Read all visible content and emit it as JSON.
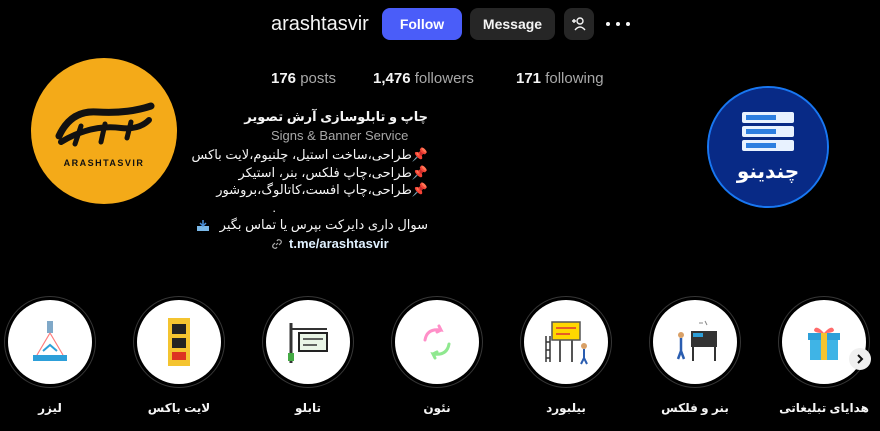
{
  "profile": {
    "username": "arashtasvir",
    "follow_label": "Follow",
    "message_label": "Message",
    "stats": {
      "posts_count": "176",
      "posts_label": "posts",
      "followers_count": "1,476",
      "followers_label": "followers",
      "following_count": "171",
      "following_label": "following"
    },
    "bio": {
      "name": "چاپ و تابلوسازی آرش تصویر",
      "category": "Signs & Banner Service",
      "line1": "طراحی،ساخت استیل، چلنیوم،لایت باکس",
      "line2": "طراحی،چاپ فلکس، بنر، استیکر",
      "line3": "طراحی،چاپ افست،کاتالوگ،بروشور",
      "line4": ".",
      "line5": "سوال داری دایرکت بپرس یا تماس بگیر",
      "pin_glyph": "📌",
      "link": "t.me/arashtasvir"
    },
    "avatar_text": "ARASHTASVIR",
    "badge_text": "چندینو"
  },
  "highlights": [
    {
      "label": "لیزر",
      "icon": "laser-icon"
    },
    {
      "label": "لایت باکس",
      "icon": "lightbox-icon"
    },
    {
      "label": "تابلو",
      "icon": "signboard-icon"
    },
    {
      "label": "نئون",
      "icon": "neon-icon"
    },
    {
      "label": "بیلبورد",
      "icon": "billboard-icon"
    },
    {
      "label": "بنر و فلکس",
      "icon": "banner-icon"
    },
    {
      "label": "هدایای تبلیغاتی",
      "icon": "gift-icon"
    }
  ],
  "colors": {
    "background": "#000000",
    "follow_button": "#4a5df9",
    "secondary_button": "#262626",
    "avatar": "#f4aa18"
  }
}
